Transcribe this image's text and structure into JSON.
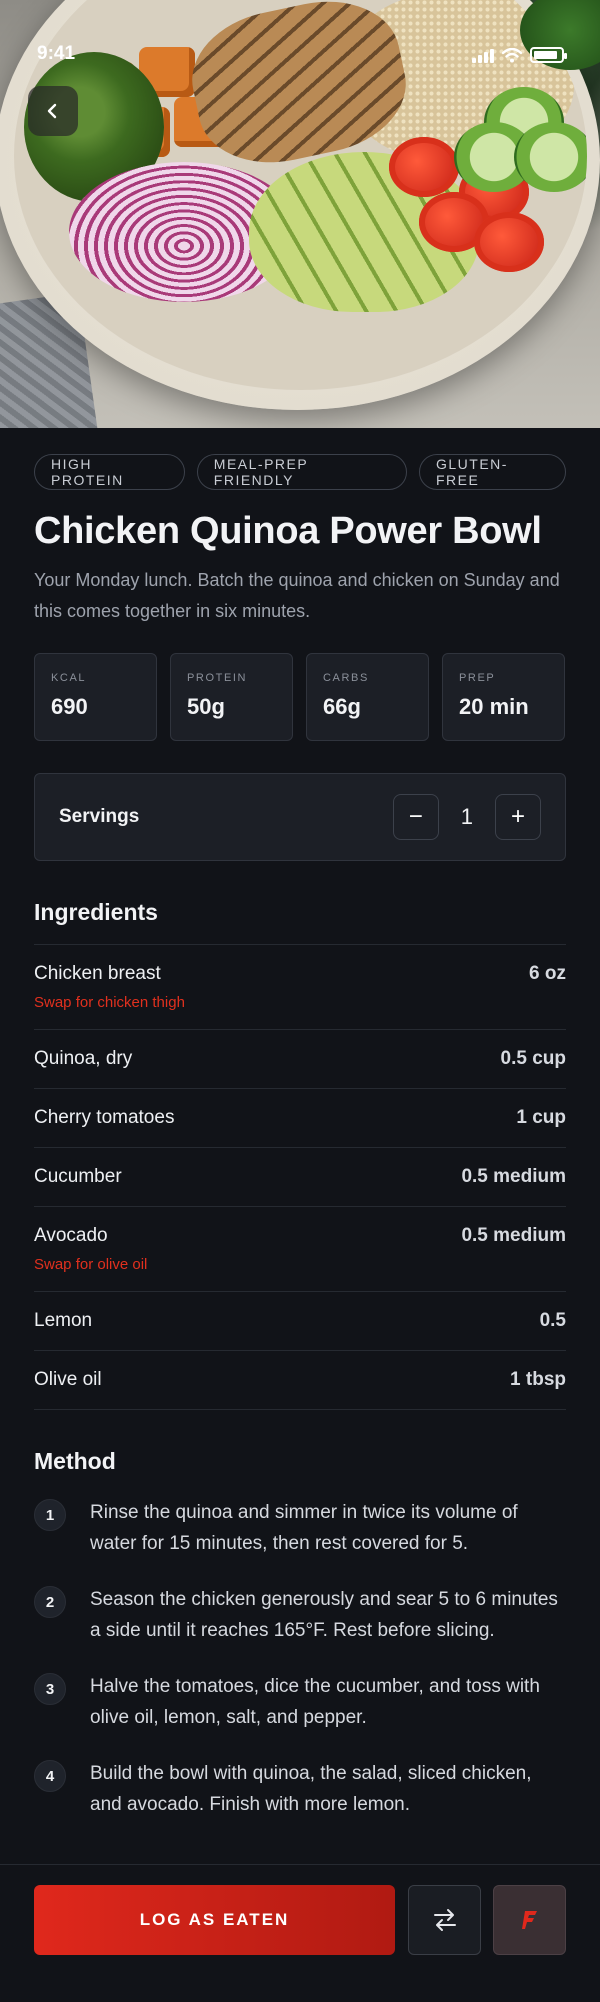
{
  "status": {
    "time": "9:41"
  },
  "tags": [
    "HIGH PROTEIN",
    "MEAL-PREP FRIENDLY",
    "GLUTEN-FREE"
  ],
  "recipe": {
    "title": "Chicken Quinoa Power Bowl",
    "subtitle": "Your Monday lunch. Batch the quinoa and chicken on Sunday and this comes together in six minutes."
  },
  "stats": [
    {
      "label": "KCAL",
      "value": "690"
    },
    {
      "label": "PROTEIN",
      "value": "50g"
    },
    {
      "label": "CARBS",
      "value": "66g"
    },
    {
      "label": "PREP",
      "value": "20 min"
    }
  ],
  "servings": {
    "label": "Servings",
    "value": "1",
    "minus": "−",
    "plus": "+"
  },
  "ingredients_heading": "Ingredients",
  "ingredients": [
    {
      "name": "Chicken breast",
      "qty": "6 oz",
      "swap": "Swap for chicken thigh"
    },
    {
      "name": "Quinoa, dry",
      "qty": "0.5 cup",
      "swap": ""
    },
    {
      "name": "Cherry tomatoes",
      "qty": "1 cup",
      "swap": ""
    },
    {
      "name": "Cucumber",
      "qty": "0.5 medium",
      "swap": ""
    },
    {
      "name": "Avocado",
      "qty": "0.5 medium",
      "swap": "Swap for olive oil"
    },
    {
      "name": "Lemon",
      "qty": "0.5",
      "swap": ""
    },
    {
      "name": "Olive oil",
      "qty": "1 tbsp",
      "swap": ""
    }
  ],
  "method_heading": "Method",
  "method": [
    {
      "num": "1",
      "text": "Rinse the quinoa and simmer in twice its volume of water for 15 minutes, then rest covered for 5."
    },
    {
      "num": "2",
      "text": "Season the chicken generously and sear 5 to 6 minutes a side until it reaches 165°F. Rest before slicing."
    },
    {
      "num": "3",
      "text": "Halve the tomatoes, dice the cucumber, and toss with olive oil, lemon, salt, and pepper."
    },
    {
      "num": "4",
      "text": "Build the bowl with quinoa, the salad, sliced chicken, and avocado. Finish with more lemon."
    }
  ],
  "actions": {
    "log_label": "LOG AS EATEN",
    "swap_icon": "swap-arrows-icon",
    "fav_icon": "flame-icon"
  },
  "colors": {
    "accent": "#e0281c",
    "background": "#111318",
    "card": "#1c1f26",
    "swap_text": "#e0301e"
  }
}
